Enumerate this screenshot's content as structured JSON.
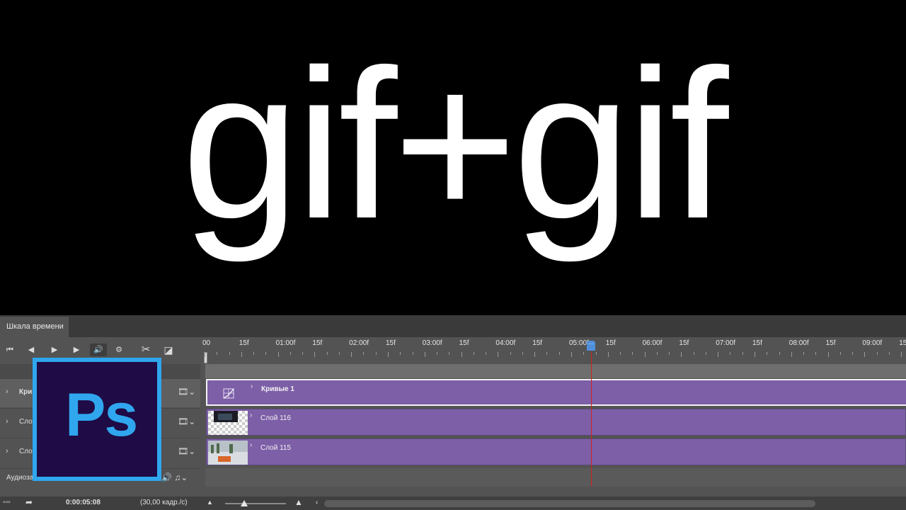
{
  "canvas": {
    "headline": "gif+gif"
  },
  "timeline": {
    "tab_label": "Шкала времени",
    "controls": {
      "first_frame": "⏮",
      "prev_frame": "◀",
      "play": "▶",
      "next_frame": "▶",
      "audio": "🔊",
      "settings": "⚙",
      "split": "✂",
      "transition": "◪"
    },
    "ruler_labels": [
      "00",
      "15f",
      "01:00f",
      "15f",
      "02:00f",
      "15f",
      "03:00f",
      "15f",
      "04:00f",
      "15f",
      "05:00f",
      "15f",
      "06:00f",
      "15f",
      "07:00f",
      "15f",
      "08:00f",
      "15f",
      "09:00f",
      "15"
    ],
    "layers": [
      {
        "name": "Кри",
        "clip_name": "Кривые 1",
        "selected": true
      },
      {
        "name": "Слой",
        "clip_name": "Слой 116",
        "selected": false
      },
      {
        "name": "Слой",
        "clip_name": "Слой 115",
        "selected": false
      }
    ],
    "audio_track_label": "Аудиоза",
    "current_time": "0:00:05:08",
    "frame_rate": "(30,00 кадр./с)",
    "playhead_time_seconds": 5.27,
    "clip_color": "#7d5fa8",
    "playhead_color": "#d42020"
  },
  "logo": {
    "text": "Ps",
    "border_color": "#2fa6ee",
    "bg_color": "#1f0b45"
  }
}
